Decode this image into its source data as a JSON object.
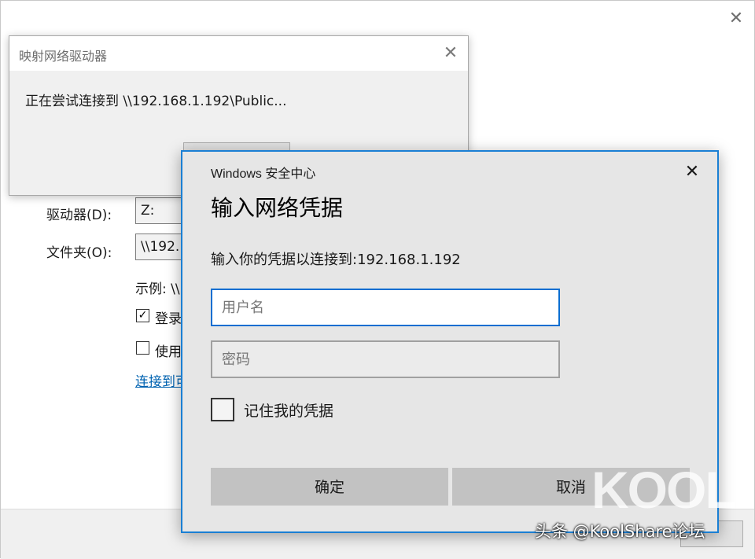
{
  "background_window": {
    "close_glyph": "✕",
    "drive_label": "驱动器(D):",
    "drive_value": "Z:",
    "folder_label": "文件夹(O):",
    "folder_value": "\\\\192.",
    "example_text": "示例: \\\\",
    "reconnect_check_mark": "✓",
    "reconnect_label": "登录",
    "other_credentials_label": "使用",
    "connect_link": "连接到可"
  },
  "connect_dialog": {
    "title": "映射网络驱动器",
    "close_glyph": "✕",
    "message": "正在尝试连接到 \\\\192.168.1.192\\Public..."
  },
  "security_dialog": {
    "header": "Windows 安全中心",
    "close_glyph": "✕",
    "title": "输入网络凭据",
    "subtitle": "输入你的凭据以连接到:192.168.1.192",
    "username_placeholder": "用户名",
    "password_placeholder": "密码",
    "remember_label": "记住我的凭据",
    "ok_label": "确定",
    "cancel_label": "取消"
  },
  "watermark": {
    "logo": "KOOL",
    "caption": "头条 @KoolShare论坛"
  },
  "colors": {
    "accent_border": "#1a7fd4",
    "input_focus_border": "#0a6ed1",
    "link": "#0063b1",
    "button_bg": "#c2c2c2",
    "dialog_bg": "#e6e6e6"
  }
}
